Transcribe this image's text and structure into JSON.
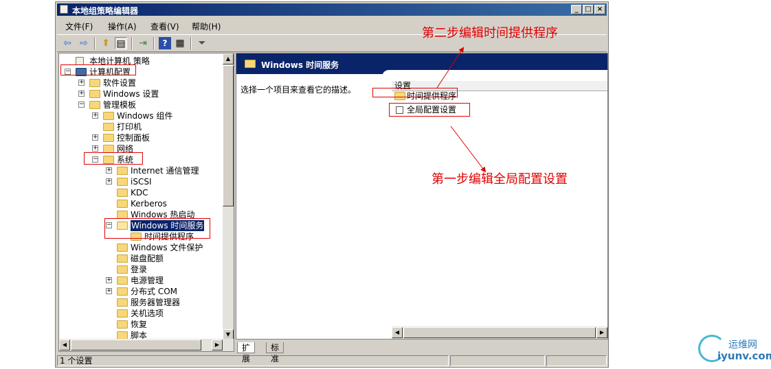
{
  "window": {
    "title": "本地组策略编辑器"
  },
  "menu": [
    "文件(F)",
    "操作(A)",
    "查看(V)",
    "帮助(H)"
  ],
  "tree": [
    {
      "label": "本地计算机 策略",
      "level": 0,
      "exp": "",
      "icon": "policy"
    },
    {
      "label": "计算机配置",
      "level": 0,
      "exp": "−",
      "icon": "computer"
    },
    {
      "label": "软件设置",
      "level": 1,
      "exp": "+",
      "icon": "folder"
    },
    {
      "label": "Windows 设置",
      "level": 1,
      "exp": "+",
      "icon": "folder"
    },
    {
      "label": "管理模板",
      "level": 1,
      "exp": "−",
      "icon": "folder"
    },
    {
      "label": "Windows 组件",
      "level": 2,
      "exp": "+",
      "icon": "folder"
    },
    {
      "label": "打印机",
      "level": 2,
      "exp": "",
      "icon": "folder"
    },
    {
      "label": "控制面板",
      "level": 2,
      "exp": "+",
      "icon": "folder"
    },
    {
      "label": "网络",
      "level": 2,
      "exp": "+",
      "icon": "folder"
    },
    {
      "label": "系统",
      "level": 2,
      "exp": "−",
      "icon": "folder"
    },
    {
      "label": "Internet 通信管理",
      "level": 3,
      "exp": "+",
      "icon": "folder"
    },
    {
      "label": "iSCSI",
      "level": 3,
      "exp": "+",
      "icon": "folder"
    },
    {
      "label": "KDC",
      "level": 3,
      "exp": "",
      "icon": "folder"
    },
    {
      "label": "Kerberos",
      "level": 3,
      "exp": "",
      "icon": "folder"
    },
    {
      "label": "Windows 热启动",
      "level": 3,
      "exp": "",
      "icon": "folder"
    },
    {
      "label": "Windows 时间服务",
      "level": 3,
      "exp": "−",
      "icon": "folder-open",
      "selected": true
    },
    {
      "label": "时间提供程序",
      "level": 4,
      "exp": "",
      "icon": "folder"
    },
    {
      "label": "Windows 文件保护",
      "level": 3,
      "exp": "",
      "icon": "folder"
    },
    {
      "label": "磁盘配额",
      "level": 3,
      "exp": "",
      "icon": "folder"
    },
    {
      "label": "登录",
      "level": 3,
      "exp": "",
      "icon": "folder"
    },
    {
      "label": "电源管理",
      "level": 3,
      "exp": "+",
      "icon": "folder"
    },
    {
      "label": "分布式 COM",
      "level": 3,
      "exp": "+",
      "icon": "folder"
    },
    {
      "label": "服务器管理器",
      "level": 3,
      "exp": "",
      "icon": "folder"
    },
    {
      "label": "关机选项",
      "level": 3,
      "exp": "",
      "icon": "folder"
    },
    {
      "label": "恢复",
      "level": 3,
      "exp": "",
      "icon": "folder"
    },
    {
      "label": "脚本",
      "level": 3,
      "exp": "",
      "icon": "folder"
    }
  ],
  "right": {
    "header": "Windows 时间服务",
    "description": "选择一个项目来查看它的描述。",
    "column": "设置",
    "items": [
      {
        "label": "时间提供程序",
        "icon": "folder"
      },
      {
        "label": "全局配置设置",
        "icon": "setting"
      }
    ]
  },
  "tabs": [
    "扩展",
    "标准"
  ],
  "status": {
    "text": "1 个设置"
  },
  "annotations": {
    "step2": "第二步编辑时间提供程序",
    "step1": "第一步编辑全局配置设置"
  },
  "annotation_color": "#e00000",
  "watermark": {
    "line1": "运维网",
    "line2": "iyunv.com"
  }
}
